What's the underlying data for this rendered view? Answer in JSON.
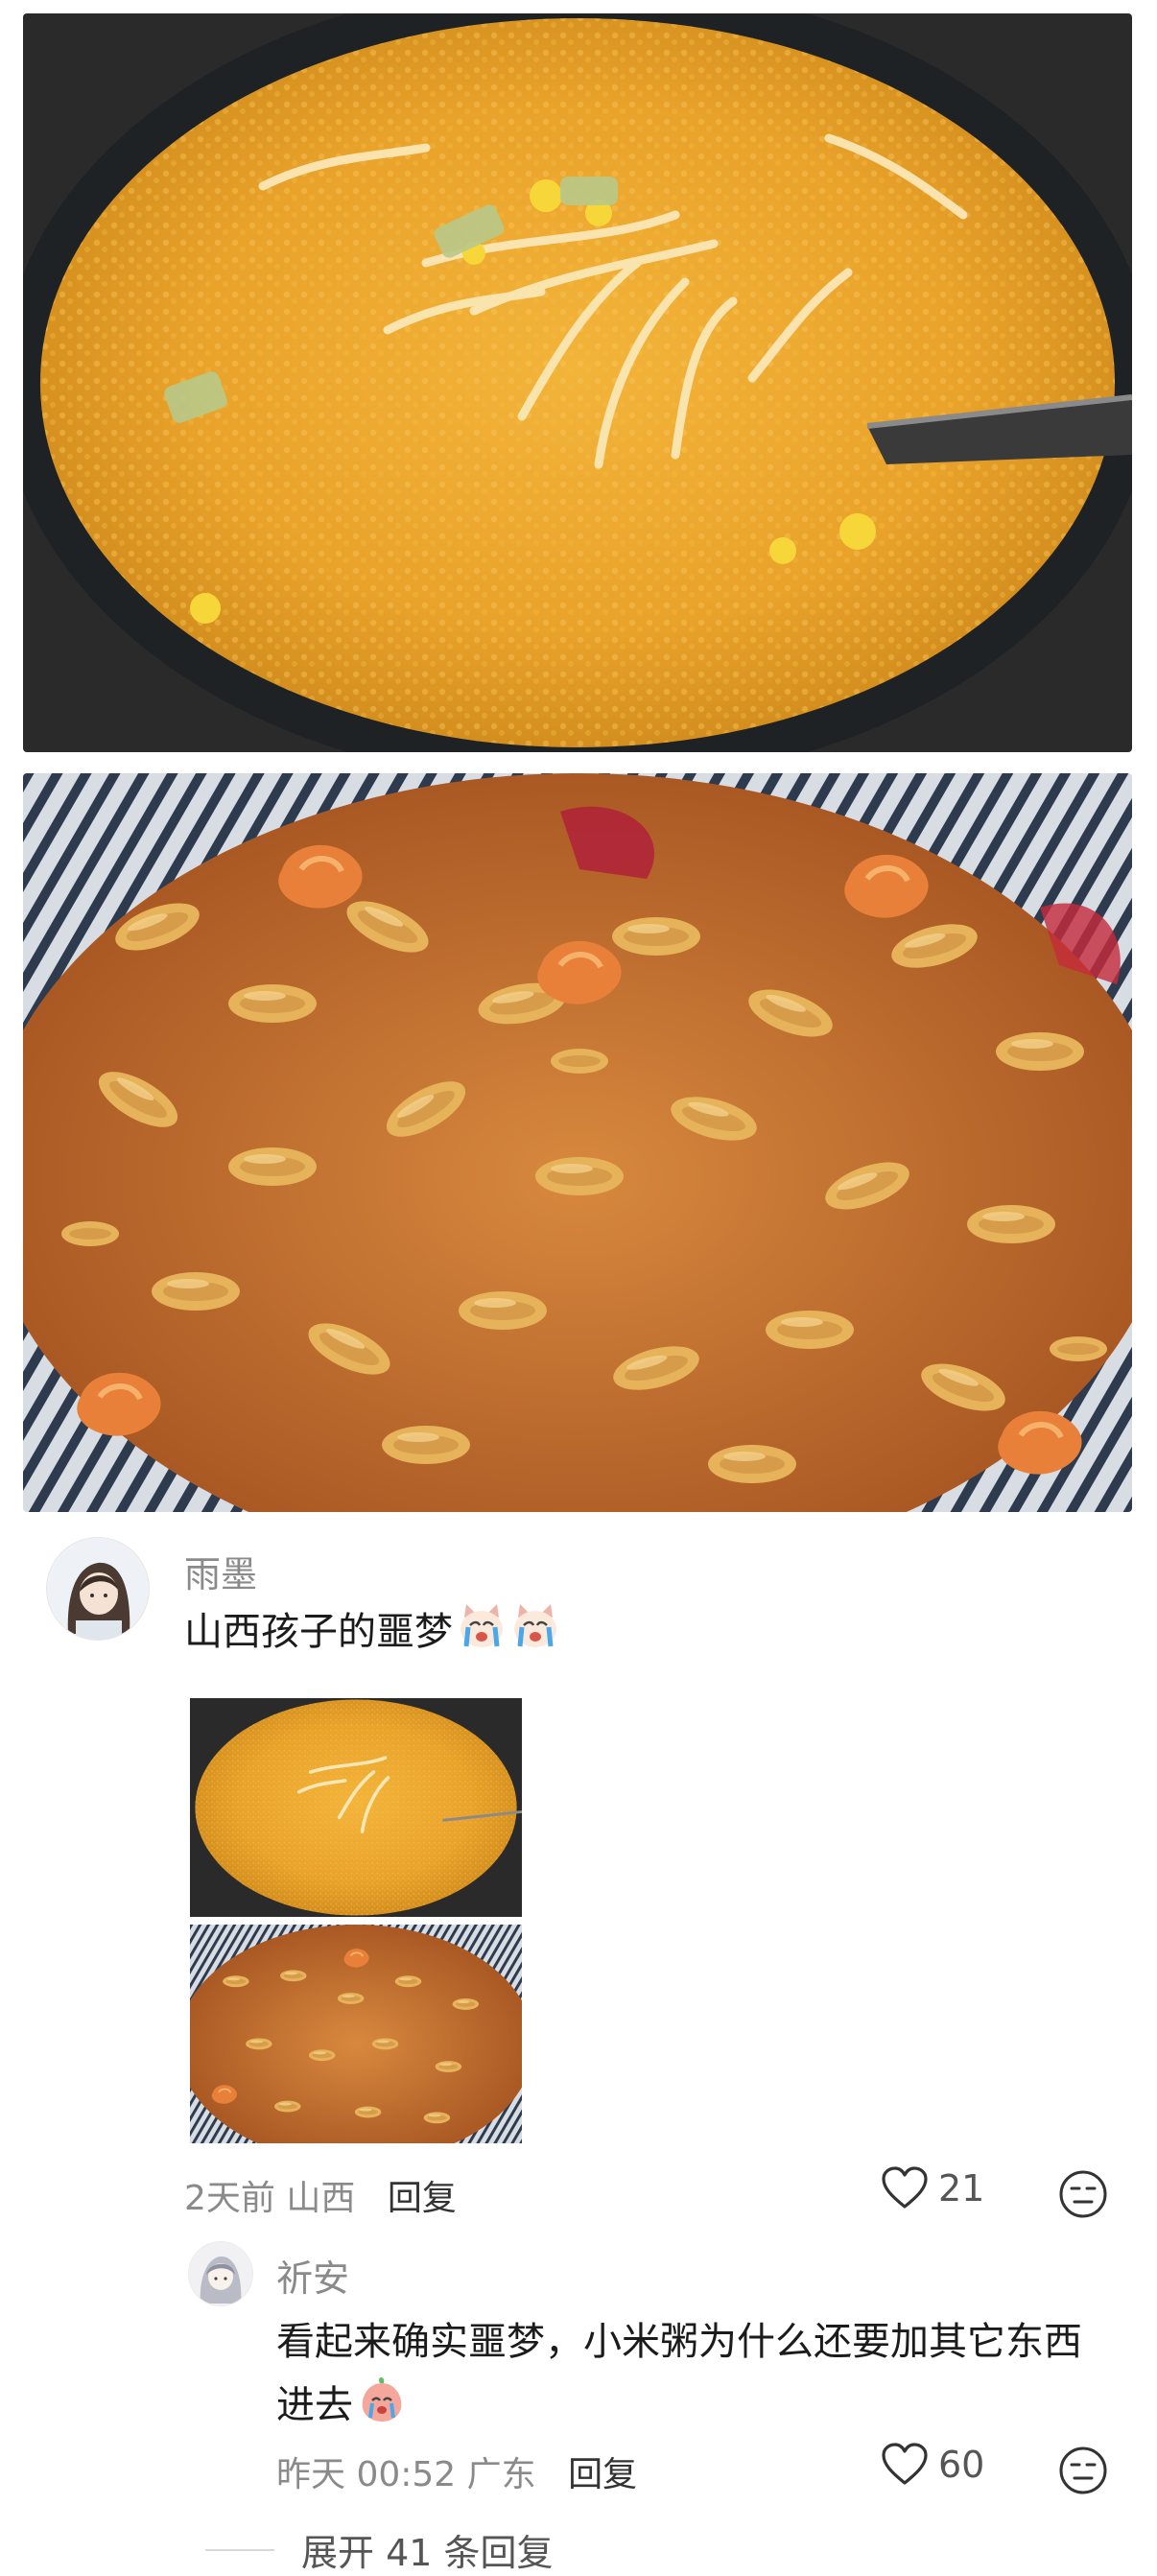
{
  "comment": {
    "username": "雨墨",
    "text": "山西孩子的噩梦",
    "emoji": [
      "crying-cat-emoji",
      "crying-cat-emoji"
    ],
    "time": "2天前",
    "location": "山西",
    "reply_label": "回复",
    "likes": "21"
  },
  "reply": {
    "username": "祈安",
    "text": "看起来确实噩梦，小米粥为什么还要加其它东西进去",
    "emoji": [
      "crying-peach-emoji"
    ],
    "time": "昨天 00:52",
    "location": "广东",
    "reply_label": "回复",
    "likes": "60"
  },
  "expand_label": "展开 41 条回复",
  "icons": [
    "heart-icon",
    "dislike-face-icon"
  ],
  "colors": {
    "meta_gray": "#8a8a8a",
    "text": "#1b1b1b"
  }
}
